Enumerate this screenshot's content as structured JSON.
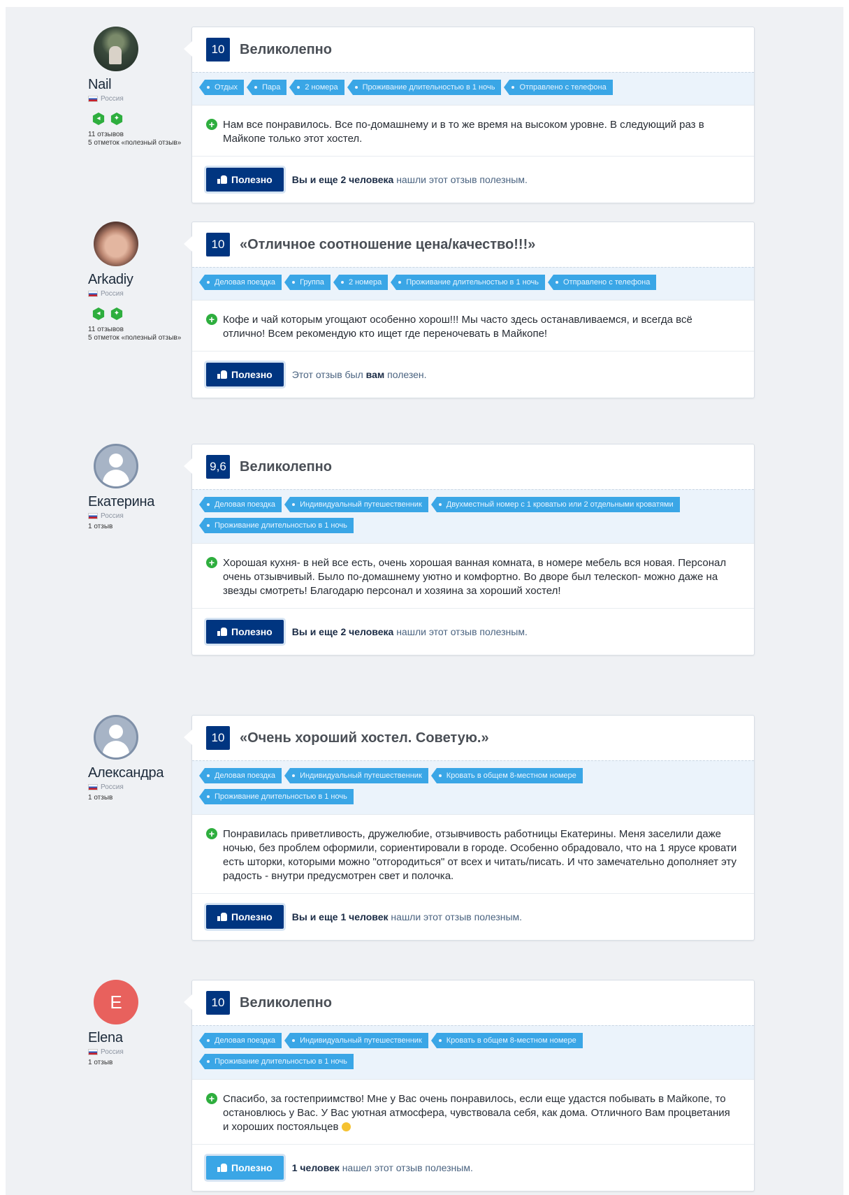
{
  "helpful_label": "Полезно",
  "country": "Россия",
  "reviews": [
    {
      "name": "Nail",
      "stats": [
        "11 отзывов",
        "5 отметок «полезный отзыв»"
      ],
      "score": "10",
      "title": "Великолепно",
      "tags": [
        "Отдых",
        "Пара",
        "2 номера",
        "Проживание длительностью в 1 ночь",
        "Отправлено с телефона"
      ],
      "text": "Нам все понравилось. Все по-домашнему и в то же время на высоком уровне. В следующий раз в Майкопе только этот хостел.",
      "helpful_bold": "Вы и еще 2 человека",
      "helpful_rest": " нашли этот отзыв полезным."
    },
    {
      "name": "Arkadiy",
      "stats": [
        "11 отзывов",
        "5 отметок «полезный отзыв»"
      ],
      "score": "10",
      "title": "«Отличное соотношение цена/качество!!!»",
      "tags": [
        "Деловая поездка",
        "Группа",
        "2 номера",
        "Проживание длительностью в 1 ночь",
        "Отправлено с телефона"
      ],
      "text": "Кофе и чай которым угощают особенно хорош!!! Мы часто здесь останавливаемся, и всегда всё отлично! Всем рекомендую кто ищет где переночевать в Майкопе!",
      "helpful_pre": "Этот отзыв был ",
      "helpful_bold": "вам",
      "helpful_rest": " полезен."
    },
    {
      "name": "Екатерина",
      "stats": [
        "1 отзыв"
      ],
      "score": "9,6",
      "title": "Великолепно",
      "tags": [
        "Деловая поездка",
        "Индивидуальный путешественник",
        "Двухместный номер с 1 кроватью или 2 отдельными кроватями",
        "Проживание длительностью в 1 ночь"
      ],
      "text": "Хорошая кухня- в ней все есть, очень хорошая ванная комната, в номере мебель вся новая. Персонал очень отзывчивый. Было по-домашнему уютно и комфортно. Во дворе был телескоп- можно даже на звезды смотреть! Благодарю персонал и хозяина за хороший хостел!",
      "helpful_bold": "Вы и еще 2 человека",
      "helpful_rest": " нашли этот отзыв полезным."
    },
    {
      "name": "Александра",
      "stats": [
        "1 отзыв"
      ],
      "score": "10",
      "title": "«Очень хороший хостел. Советую.»",
      "tags": [
        "Деловая поездка",
        "Индивидуальный путешественник",
        "Кровать в общем 8-местном номере",
        "Проживание длительностью в 1 ночь"
      ],
      "text": "Понравилась приветливость, дружелюбие, отзывчивость работницы Екатерины. Меня заселили даже ночью, без проблем оформили, сориентировали в городе. Особенно обрадовало, что на 1 ярусе кровати есть шторки, которыми можно \"отгородиться\" от всех и читать/писать. И что замечательно дополняет эту радость - внутри предусмотрен свет и полочка.",
      "helpful_bold": "Вы и еще 1 человек",
      "helpful_rest": " нашли этот отзыв полезным."
    },
    {
      "name": "Elena",
      "avatar_letter": "E",
      "stats": [
        "1 отзыв"
      ],
      "score": "10",
      "title": "Великолепно",
      "tags": [
        "Деловая поездка",
        "Индивидуальный путешественник",
        "Кровать в общем 8-местном номере",
        "Проживание длительностью в 1 ночь"
      ],
      "text": "Спасибо, за гостеприимство! Мне у Вас очень понравилось, если еще удастся побывать в Майкопе, то остановлюсь у Вас. У Вас уютная атмосфера, чувствовала себя, как дома. Отличного Вам процветания и хороших постояльцев",
      "helpful_bold": "1 человек",
      "helpful_rest": " нашел этот отзыв полезным."
    }
  ]
}
